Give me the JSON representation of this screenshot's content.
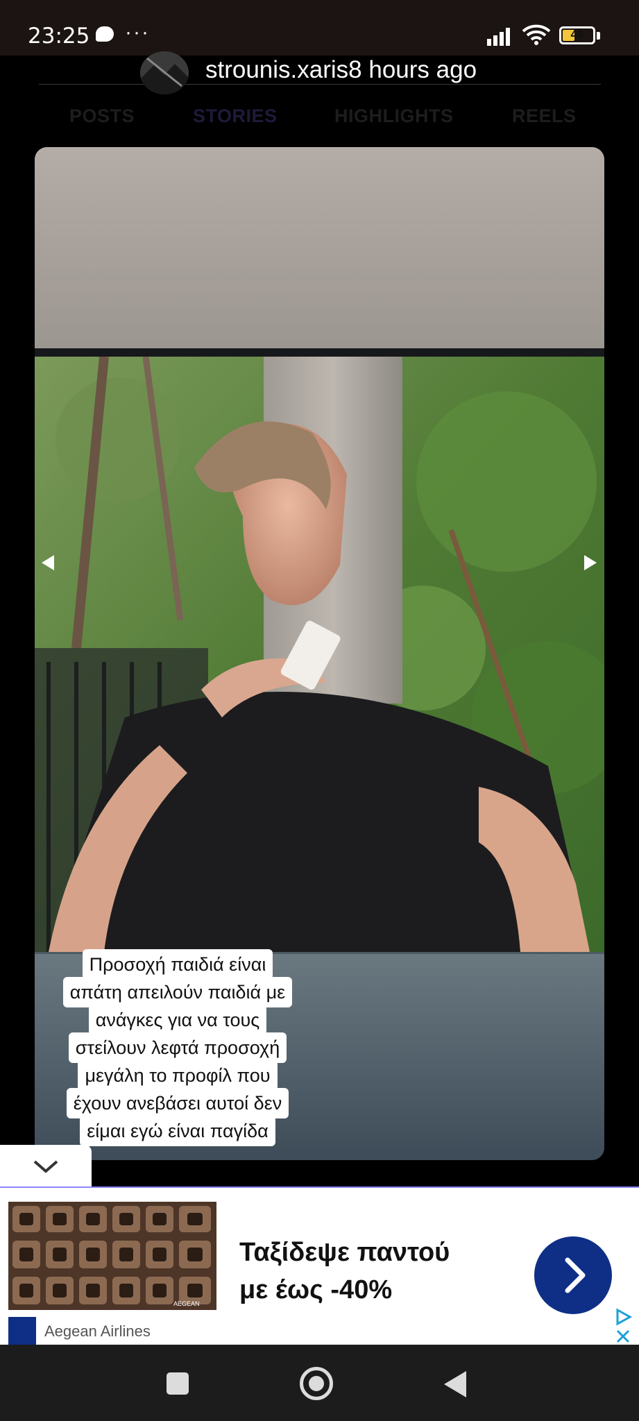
{
  "status_bar": {
    "time": "23:25",
    "dots": "···",
    "battery_level": "40",
    "icons": [
      "chat-bubble-icon",
      "signal-icon",
      "wifi-icon",
      "battery-icon"
    ]
  },
  "post": {
    "username_time": "strounis.xaris8 hours ago"
  },
  "tabs": [
    {
      "label": "POSTS"
    },
    {
      "label": "STORIES"
    },
    {
      "label": "HIGHLIGHTS"
    },
    {
      "label": "REELS"
    }
  ],
  "story": {
    "caption_lines": [
      "Προσοχή παιδιά είναι",
      "απάτη απειλούν παιδιά με",
      "ανάγκες για να τους",
      "στείλουν λεφτά προσοχή",
      "μεγάλη το προφίλ που",
      "έχουν ανεβάσει αυτοί δεν",
      "είμαι εγώ είναι παγίδα"
    ]
  },
  "ad": {
    "headline_line1": "Ταξίδεψε παντού",
    "headline_line2": "με έως -40%",
    "brand": "Aegean Airlines",
    "image_label": "AEGEAN",
    "cta_icon": "chevron-right-icon",
    "cta_color": "#0f2f87"
  },
  "nav_bar": {
    "icons": [
      "recents-square-icon",
      "home-circle-icon",
      "back-triangle-icon"
    ]
  }
}
